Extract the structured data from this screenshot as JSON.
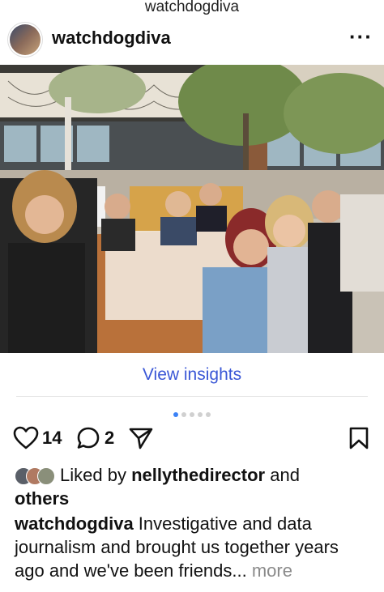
{
  "top_bar": {
    "account_title": "watchdogdiva"
  },
  "post": {
    "username": "watchdogdiva",
    "view_insights_label": "View insights",
    "carousel": {
      "total": 5,
      "active_index": 0
    },
    "likes_count": "14",
    "comments_count": "2",
    "liked_by_prefix": "Liked by ",
    "liked_by_user": "nellythedirector",
    "liked_by_suffix": " and",
    "liked_by_others": "others",
    "caption_user": "watchdogdiva",
    "caption_text": " Investigative and data journalism and brought us together years ago and we've been friends...",
    "more_label": " more"
  },
  "icons": {
    "options": "more-options-icon",
    "like": "heart-icon",
    "comment": "comment-icon",
    "share": "send-icon",
    "save": "bookmark-icon"
  },
  "colors": {
    "link": "#3a57d6",
    "active_dot": "#3b82f6",
    "muted": "#8a8a8a"
  }
}
